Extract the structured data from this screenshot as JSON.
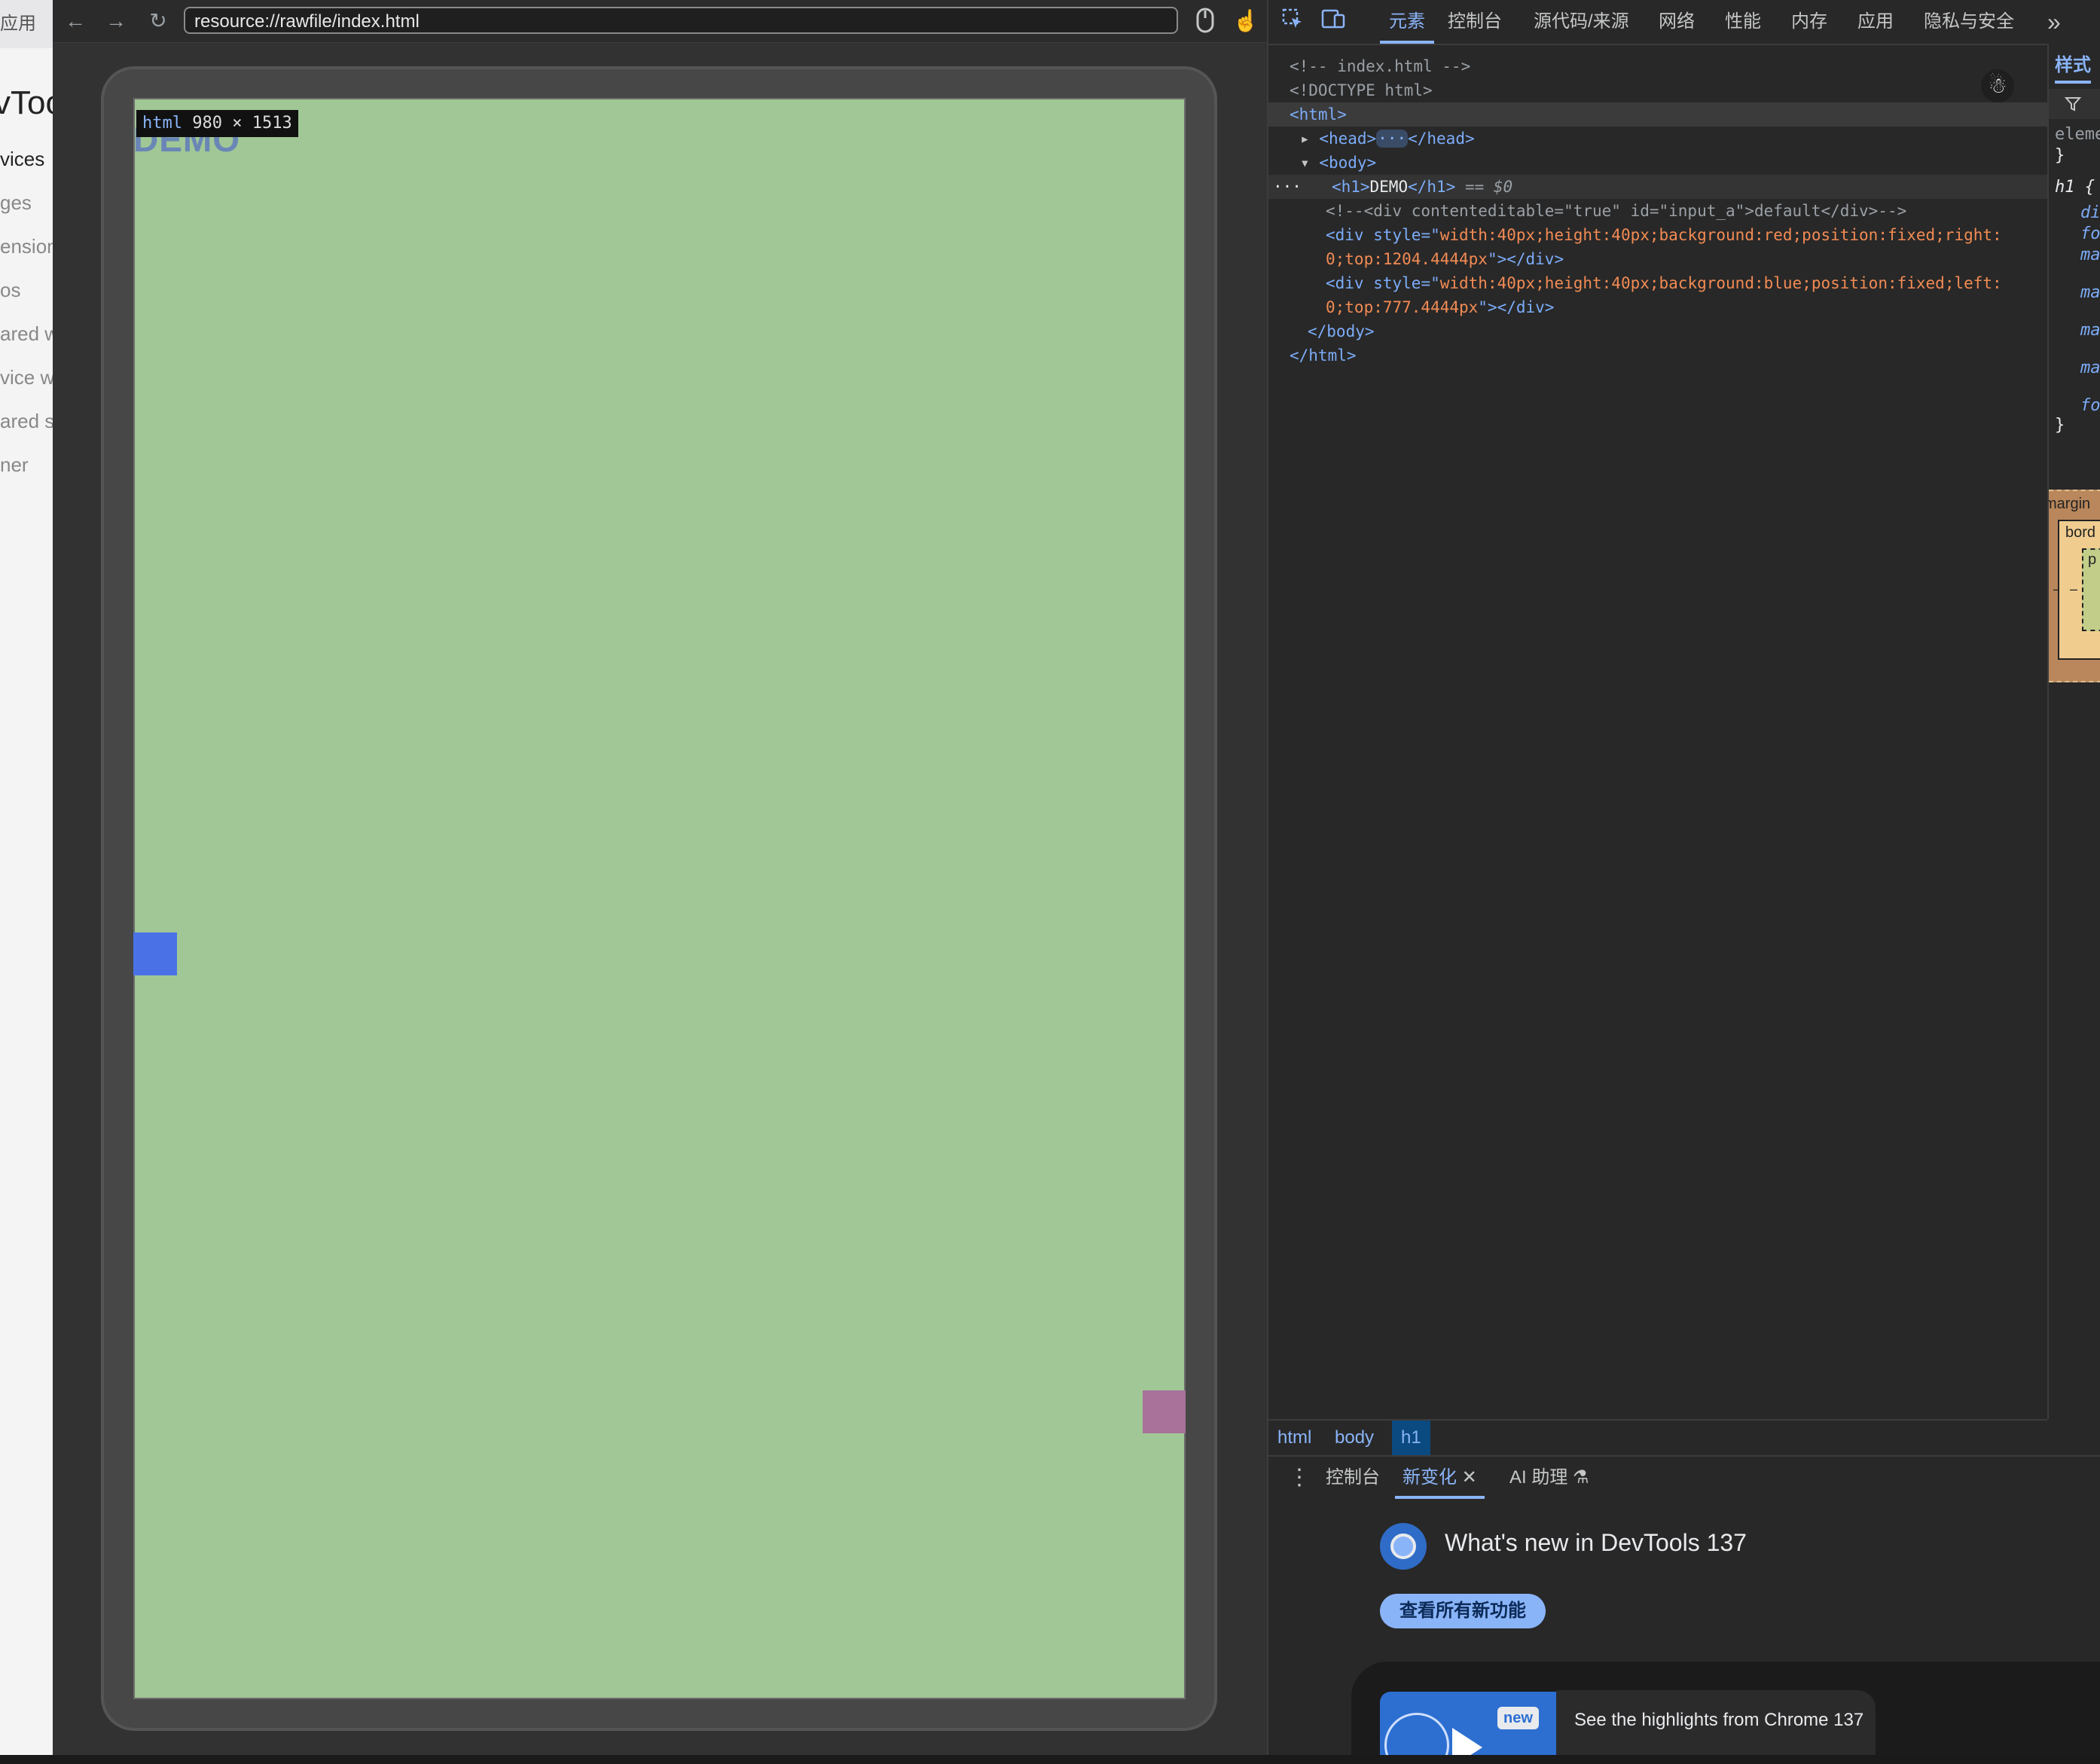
{
  "left_panel": {
    "header": "应用",
    "title_fragment": "vToo",
    "items": [
      "vices",
      "ges",
      "ension",
      "os",
      "ared w",
      "vice w",
      "ared s",
      "ner"
    ]
  },
  "browser": {
    "url": "resource://rawfile/index.html",
    "page": {
      "heading": "DEMO",
      "size_tooltip_tag": "html",
      "size_tooltip_dims": "980 × 1513",
      "background_color": "#a0c795",
      "blue_box_color": "#4a72e6",
      "red_box_color": "#a8729a"
    }
  },
  "devtools": {
    "tabs": [
      "元素",
      "控制台",
      "源代码/来源",
      "网络",
      "性能",
      "内存",
      "应用",
      "隐私与安全"
    ],
    "active_tab": "元素",
    "more_tabs": "»",
    "dom": {
      "l1": "<!-- index.html -->",
      "l2": "<!DOCTYPE html>",
      "l3_tag": "<html>",
      "l4_open": "<head>",
      "l4_ellipsis": "···",
      "l4_close": "</head>",
      "l5": "<body>",
      "l6_dots": "···",
      "l6_open": "<h1>",
      "l6_text": "DEMO",
      "l6_close": "</h1>",
      "l6_marker": " == $0",
      "l7": "<!--<div contenteditable=\"true\" id=\"input_a\">default</div>-->",
      "l8_tag": "<div ",
      "l8_attr": "style",
      "l8_eq": "=\"",
      "l8_val": "width:40px;height:40px;background:red;position:fixed;right:",
      "l9_val": "0;top:1204.4444px",
      "l9_end": "\"></div>",
      "l10_tag": "<div ",
      "l10_attr": "style",
      "l10_eq": "=\"",
      "l10_val": "width:40px;height:40px;background:blue;position:fixed;left:",
      "l11_val": "0;top:777.4444px",
      "l11_end": "\"></div>",
      "l12": "</body>",
      "l13": "</html>"
    },
    "styles_pane": {
      "tab": "样式",
      "filter_icon": "funnel",
      "element_label": "eleme",
      "brace_close": "}",
      "rule_selector": "h1 {",
      "props": [
        "di",
        "fo",
        "ma",
        "ma",
        "ma",
        "ma",
        "fo"
      ],
      "rule_close": "}",
      "box_margin": "margin",
      "box_border": "bord",
      "box_padding": "p",
      "box_dash": "–",
      "box_inner_dash": "–"
    },
    "breadcrumbs": [
      "html",
      "body",
      "h1"
    ],
    "drawer_tabs": [
      "控制台",
      "新变化",
      "AI 助理"
    ],
    "drawer_active": "新变化",
    "whats_new_title": "What's new in DevTools 137",
    "see_all_button": "查看所有新功能",
    "video_badge": "new",
    "video_caption": "See the highlights from Chrome 137"
  }
}
